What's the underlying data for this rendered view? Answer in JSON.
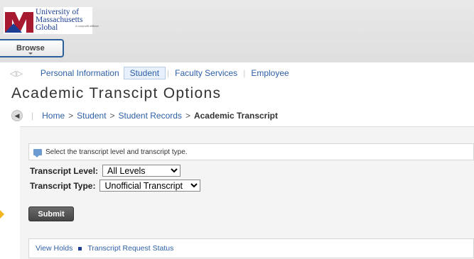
{
  "logo": {
    "line1": "University of",
    "line2": "Massachusetts",
    "line3": "Global",
    "tagline": "A nonprofit affiliate"
  },
  "header": {
    "browse_label": "Browse"
  },
  "nav": {
    "items": [
      {
        "label": "Personal Information",
        "active": false
      },
      {
        "label": "Student",
        "active": true
      },
      {
        "label": "Faculty Services",
        "active": false
      },
      {
        "label": "Employee",
        "active": false
      }
    ]
  },
  "page": {
    "title": "Academic Transcipt Options"
  },
  "breadcrumb": {
    "home": "Home",
    "student": "Student",
    "records": "Student Records",
    "current": "Academic Transcript",
    "separator": ">"
  },
  "form": {
    "info_message": "Select the transcript level and transcript type.",
    "level_label": "Transcript Level:",
    "level_value": "All Levels",
    "type_label": "Transcript Type:",
    "type_value": "Unofficial Transcript",
    "submit_label": "Submit"
  },
  "links": {
    "holds": "View Holds",
    "request_status": "Transcript Request Status"
  },
  "colors": {
    "brand_blue": "#1c3f94",
    "brand_red": "#a6192e",
    "link": "#2d5fa6",
    "pointer": "#f2b620"
  }
}
